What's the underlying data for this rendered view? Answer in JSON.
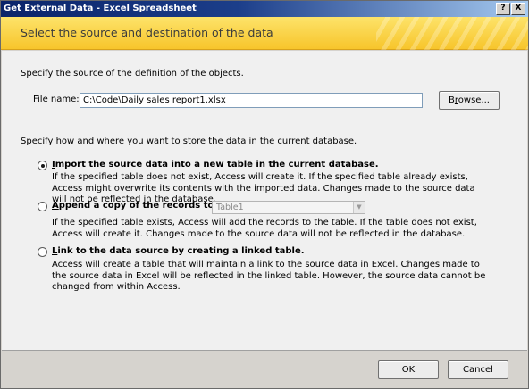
{
  "window": {
    "title": "Get External Data - Excel Spreadsheet",
    "help_label": "?",
    "close_label": "X"
  },
  "banner": {
    "title": "Select the source and destination of the data"
  },
  "source": {
    "heading": "Specify the source of the definition of the objects.",
    "file_label_mnemonic": "F",
    "file_label_rest": "ile name:",
    "file_value": "C:\\Code\\Daily sales report1.xlsx",
    "browse_mnemonic": "r",
    "browse_pre": "B",
    "browse_post": "owse..."
  },
  "destination": {
    "heading": "Specify how and where you want to store the data in the current database.",
    "options": [
      {
        "mnemonic": "I",
        "title_rest": "mport the source data into a new table in the current database.",
        "description": "If the specified table does not exist, Access will create it. If the specified table already exists, Access might overwrite its contents with the imported data. Changes made to the source data will not be reflected in the database.",
        "selected": true
      },
      {
        "mnemonic": "A",
        "title_rest": "ppend a copy of the records to the table:",
        "description": "If the specified table exists, Access will add the records to the table. If the table does not exist, Access will create it. Changes made to the source data will not be reflected in the database.",
        "selected": false
      },
      {
        "mnemonic": "L",
        "title_rest": "ink to the data source by creating a linked table.",
        "description": "Access will create a table that will maintain a link to the source data in Excel. Changes made to the source data in Excel will be reflected in the linked table. However, the source data cannot be changed from within Access.",
        "selected": false
      }
    ],
    "append_table_value": "Table1",
    "append_table_arrow": "▼"
  },
  "footer": {
    "ok_label": "OK",
    "cancel_label": "Cancel"
  }
}
